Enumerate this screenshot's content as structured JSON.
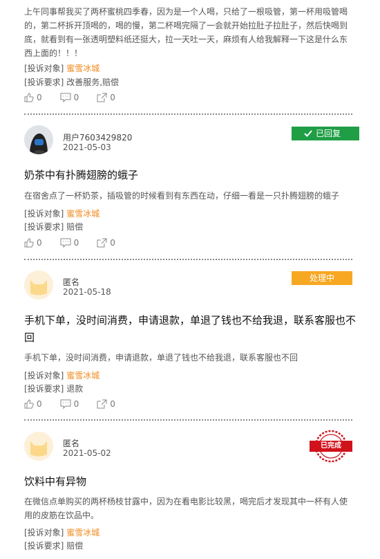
{
  "items": [
    {
      "body": "上午同事帮我买了两杯蜜桃四季春，因为是一个人喝，只给了一根吸管，第一杯用吸管喝的，第二杯拆开顶喝的，喝的慢，第二杯喝完隔了一会就开始拉肚子拉肚子，然后快喝到底，就看到有一张透明塑料纸还挺大，拉一天吐一天，麻烦有人给我解释一下这是什么东西上面的！！！",
      "target_label": "[投诉对象]",
      "target_value": "蜜雪冰城",
      "request_label": "[投诉要求]",
      "request_value": "改善服务,赔偿",
      "likes": "0",
      "comments": "0",
      "shares": "0"
    },
    {
      "user": "用户7603429820",
      "date": "2021-05-03",
      "status": "已回复",
      "title": "奶茶中有扑腾翅膀的蛾子",
      "body": "在宿舍点了一杯奶茶，插吸管的时候看到有东西在动，仔细一看是一只扑腾翅膀的蛾子",
      "target_label": "[投诉对象]",
      "target_value": "蜜雪冰城",
      "request_label": "[投诉要求]",
      "request_value": "赔偿",
      "likes": "0",
      "comments": "0",
      "shares": "0"
    },
    {
      "user": "匿名",
      "date": "2021-05-18",
      "status": "处理中",
      "title": "手机下单，没时间消费，申请退款，单退了钱也不给我退，联系客服也不回",
      "body": "手机下单，没时间消费，申请退款，单退了钱也不给我退，联系客服也不回",
      "target_label": "[投诉对象]",
      "target_value": "蜜雪冰城",
      "request_label": "[投诉要求]",
      "request_value": "退款",
      "likes": "0",
      "comments": "0",
      "shares": "0"
    },
    {
      "user": "匿名",
      "date": "2021-05-02",
      "status": "已完成",
      "title": "饮料中有异物",
      "body": "在微信点单购买的两杯杨枝甘露中，因为在看电影比较黑，喝完后才发现其中一杯有人使用的皮筋在饮品中。",
      "target_label": "[投诉对象]",
      "target_value": "蜜雪冰城",
      "request_label": "[投诉要求]",
      "request_value": "赔偿"
    }
  ],
  "colors": {
    "brand": "#f08a1c",
    "replied": "#1f9e45",
    "processing": "#f7a823",
    "done": "#d0121b"
  }
}
